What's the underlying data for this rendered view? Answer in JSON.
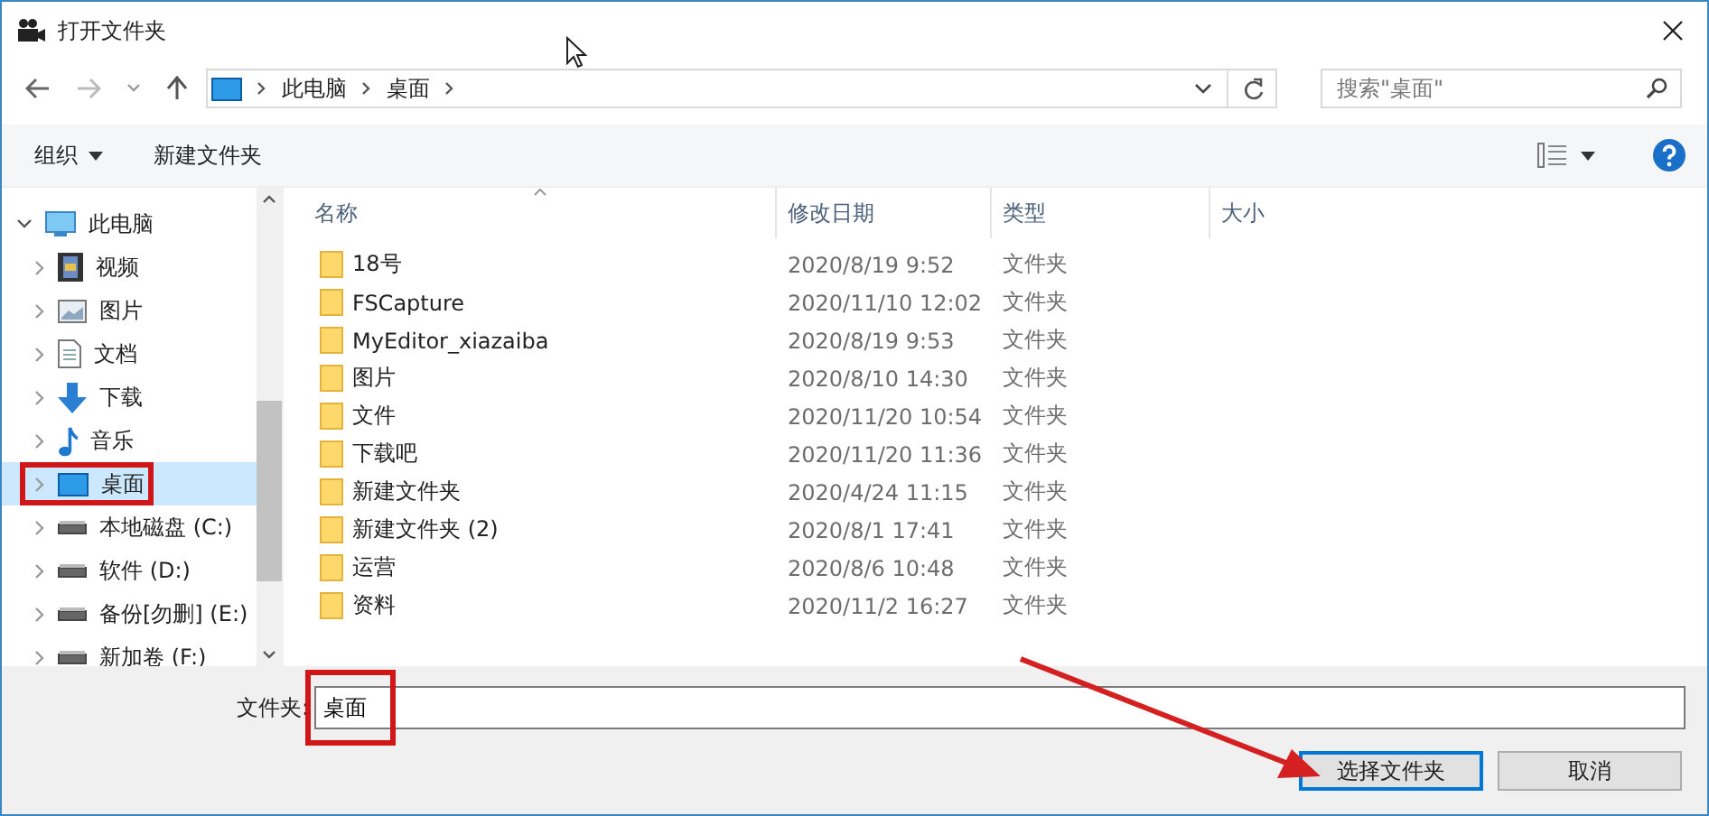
{
  "window": {
    "title": "打开文件夹"
  },
  "address_bar": {
    "path": [
      "此电脑",
      "桌面"
    ]
  },
  "search": {
    "placeholder": "搜索\"桌面\""
  },
  "toolbar": {
    "organize": "组织",
    "new_folder": "新建文件夹"
  },
  "nav_tree": [
    {
      "label": "此电脑",
      "kind": "pc",
      "selected": false,
      "expanded": true,
      "children": [
        {
          "label": "视频",
          "kind": "video",
          "selected": false,
          "highlighted": false,
          "expanded": false
        },
        {
          "label": "图片",
          "kind": "image",
          "selected": false,
          "highlighted": false,
          "expanded": false
        },
        {
          "label": "文档",
          "kind": "document",
          "selected": false,
          "highlighted": false,
          "expanded": false
        },
        {
          "label": "下载",
          "kind": "download",
          "selected": false,
          "highlighted": false,
          "expanded": false
        },
        {
          "label": "音乐",
          "kind": "music",
          "selected": false,
          "highlighted": false,
          "expanded": false
        },
        {
          "label": "桌面",
          "kind": "desktop",
          "selected": true,
          "highlighted": true,
          "expanded": false
        },
        {
          "label": "本地磁盘 (C:)",
          "kind": "drive",
          "selected": false,
          "highlighted": false,
          "expanded": false
        },
        {
          "label": "软件 (D:)",
          "kind": "drive",
          "selected": false,
          "highlighted": false,
          "expanded": false
        },
        {
          "label": "备份[勿删] (E:)",
          "kind": "drive",
          "selected": false,
          "highlighted": false,
          "expanded": false
        },
        {
          "label": "新加卷 (F:)",
          "kind": "drive",
          "selected": false,
          "highlighted": false,
          "expanded": false
        }
      ]
    }
  ],
  "table": {
    "columns": [
      "名称",
      "修改日期",
      "类型",
      "大小"
    ],
    "rows": [
      {
        "name": "18号",
        "modified": "2020/8/19 9:52",
        "type": "文件夹"
      },
      {
        "name": "FSCapture",
        "modified": "2020/11/10 12:02",
        "type": "文件夹"
      },
      {
        "name": "MyEditor_xiazaiba",
        "modified": "2020/8/19 9:53",
        "type": "文件夹"
      },
      {
        "name": "图片",
        "modified": "2020/8/10 14:30",
        "type": "文件夹"
      },
      {
        "name": "文件",
        "modified": "2020/11/20 10:54",
        "type": "文件夹"
      },
      {
        "name": "下载吧",
        "modified": "2020/11/20 11:36",
        "type": "文件夹"
      },
      {
        "name": "新建文件夹",
        "modified": "2020/4/24 11:15",
        "type": "文件夹"
      },
      {
        "name": "新建文件夹 (2)",
        "modified": "2020/8/1 17:41",
        "type": "文件夹"
      },
      {
        "name": "运营",
        "modified": "2020/8/6 10:48",
        "type": "文件夹"
      },
      {
        "name": "资料",
        "modified": "2020/11/2 16:27",
        "type": "文件夹"
      }
    ]
  },
  "folder_field": {
    "label": "文件夹:",
    "value": "桌面",
    "highlighted": true
  },
  "buttons": [
    {
      "label": "选择文件夹",
      "kind": "primary",
      "pointed": true
    },
    {
      "label": "取消",
      "kind": "secondary"
    }
  ]
}
